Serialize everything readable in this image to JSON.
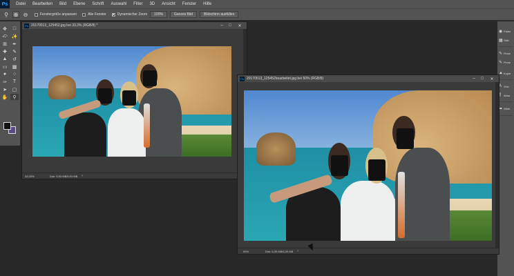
{
  "app": {
    "logo": "Ps"
  },
  "menubar": {
    "items": [
      "Datei",
      "Bearbeiten",
      "Bild",
      "Ebene",
      "Schrift",
      "Auswahl",
      "Filter",
      "3D",
      "Ansicht",
      "Fenster",
      "Hilfe"
    ]
  },
  "options": {
    "fit_windows_label": "Fenstergröße anpassen",
    "all_windows_label": "Alle Fenster",
    "scrubby_zoom_label": "Dynamischer Zoom",
    "zoom_100_label": "100%",
    "fit_screen_label": "Ganzes Bild",
    "fill_screen_label": "Bildschirm ausfüllen",
    "scrubby_zoom_checked": true
  },
  "toolbar": {
    "tools": [
      "move-icon",
      "marquee-icon",
      "lasso-icon",
      "quick-select-icon",
      "crop-icon",
      "eyedropper-icon",
      "healing-icon",
      "brush-icon",
      "stamp-icon",
      "history-brush-icon",
      "eraser-icon",
      "gradient-icon",
      "blur-icon",
      "dodge-icon",
      "pen-icon",
      "type-icon",
      "path-select-icon",
      "shape-icon",
      "hand-icon",
      "zoom-icon"
    ],
    "foreground_color": "#111111",
    "background_color": "#5a4a8a"
  },
  "right_panel": {
    "items": [
      {
        "icon": "color-icon",
        "label": "Farbe"
      },
      {
        "icon": "swatches-icon",
        "label": "Stile"
      },
      {
        "icon": "brush-panel-icon",
        "label": "Pinse"
      },
      {
        "icon": "brush-presets-icon",
        "label": "Pinse"
      },
      {
        "icon": "clone-source-icon",
        "label": "Kopie"
      },
      {
        "icon": "characters-icon",
        "label": "Zeic"
      },
      {
        "icon": "paragraph-icon",
        "label": "Absa"
      },
      {
        "icon": "paths-icon",
        "label": "Werk"
      }
    ]
  },
  "documents": {
    "doc1": {
      "title": "20170513_125452.jpg bei 33,3% (RGB/8) *",
      "zoom": "33,33%",
      "doc_size": "Dok: 5,93 MB/5,93 MB"
    },
    "doc2": {
      "title": "20170513_125452bearbeitet.jpg bei 50% (RGB/8)",
      "zoom": "50%",
      "doc_size": "Dok: 6,39 MB/6,39 MB"
    }
  }
}
